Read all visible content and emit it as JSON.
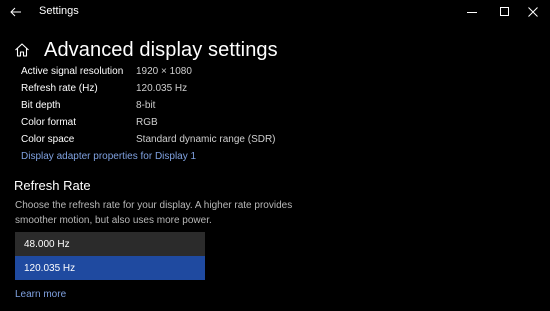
{
  "titlebar": {
    "app_title": "Settings",
    "back_icon": "back-arrow-icon",
    "minimize_icon": "minimize-icon",
    "maximize_icon": "maximize-icon",
    "close_icon": "close-icon"
  },
  "header": {
    "home_icon": "home-icon",
    "title": "Advanced display settings"
  },
  "display_info": [
    {
      "label": "Active signal resolution",
      "value": "1920 × 1080"
    },
    {
      "label": "Refresh rate (Hz)",
      "value": "120.035 Hz"
    },
    {
      "label": "Bit depth",
      "value": "8-bit"
    },
    {
      "label": "Color format",
      "value": "RGB"
    },
    {
      "label": "Color space",
      "value": "Standard dynamic range (SDR)"
    }
  ],
  "adapter_link": "Display adapter properties for Display 1",
  "refresh_rate": {
    "title": "Refresh Rate",
    "description": "Choose the refresh rate for your display. A higher rate provides smoother motion, but also uses more power.",
    "options": [
      {
        "label": "48.000 Hz",
        "selected": false
      },
      {
        "label": "120.035 Hz",
        "selected": true
      }
    ]
  },
  "learn_more": "Learn more",
  "colors": {
    "background": "#000000",
    "link": "#7fa1e0",
    "selected": "#1f4aa0",
    "dropdown_bg": "#2b2b2b"
  }
}
